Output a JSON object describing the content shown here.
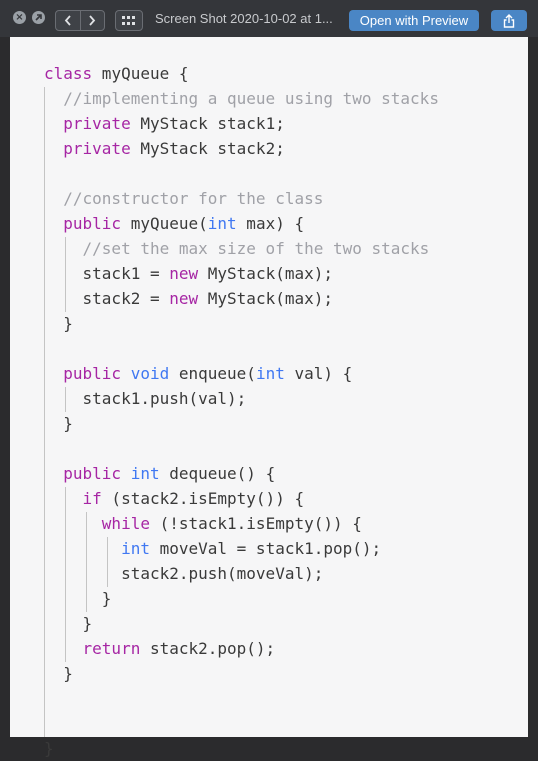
{
  "titlebar": {
    "title": "Screen Shot 2020-10-02 at 1...",
    "open_button": "Open with Preview",
    "icons": {
      "close": "close-icon",
      "fullscreen": "fullscreen-icon",
      "back": "chevron-left-icon",
      "forward": "chevron-right-icon",
      "grid": "grid-icon",
      "share": "share-icon"
    }
  },
  "colors": {
    "keyword": "#a626a4",
    "type": "#4078f2",
    "comment": "#a0a1a7",
    "text": "#3a3a3a",
    "button": "#4a86c5",
    "titlebar": "#34363a",
    "code_background": "#f6f6f7"
  },
  "code": {
    "language": "java",
    "lines": [
      [
        {
          "t": "kw",
          "s": "class"
        },
        {
          "t": "tx",
          "s": " myQueue {"
        }
      ],
      [
        {
          "t": "cm",
          "s": "  //implementing a queue using two stacks"
        }
      ],
      [
        {
          "t": "tx",
          "s": "  "
        },
        {
          "t": "kw",
          "s": "private"
        },
        {
          "t": "tx",
          "s": " MyStack stack1;"
        }
      ],
      [
        {
          "t": "tx",
          "s": "  "
        },
        {
          "t": "kw",
          "s": "private"
        },
        {
          "t": "tx",
          "s": " MyStack stack2;"
        }
      ],
      [],
      [
        {
          "t": "cm",
          "s": "  //constructor for the class"
        }
      ],
      [
        {
          "t": "tx",
          "s": "  "
        },
        {
          "t": "kw",
          "s": "public"
        },
        {
          "t": "tx",
          "s": " myQueue("
        },
        {
          "t": "ty",
          "s": "int"
        },
        {
          "t": "tx",
          "s": " max) {"
        }
      ],
      [
        {
          "t": "cm",
          "s": "    //set the max size of the two stacks"
        }
      ],
      [
        {
          "t": "tx",
          "s": "    stack1 = "
        },
        {
          "t": "kw",
          "s": "new"
        },
        {
          "t": "tx",
          "s": " MyStack(max);"
        }
      ],
      [
        {
          "t": "tx",
          "s": "    stack2 = "
        },
        {
          "t": "kw",
          "s": "new"
        },
        {
          "t": "tx",
          "s": " MyStack(max);"
        }
      ],
      [
        {
          "t": "tx",
          "s": "  }"
        }
      ],
      [],
      [
        {
          "t": "tx",
          "s": "  "
        },
        {
          "t": "kw",
          "s": "public"
        },
        {
          "t": "tx",
          "s": " "
        },
        {
          "t": "ty",
          "s": "void"
        },
        {
          "t": "tx",
          "s": " enqueue("
        },
        {
          "t": "ty",
          "s": "int"
        },
        {
          "t": "tx",
          "s": " val) {"
        }
      ],
      [
        {
          "t": "tx",
          "s": "    stack1.push(val);"
        }
      ],
      [
        {
          "t": "tx",
          "s": "  }"
        }
      ],
      [],
      [
        {
          "t": "tx",
          "s": "  "
        },
        {
          "t": "kw",
          "s": "public"
        },
        {
          "t": "tx",
          "s": " "
        },
        {
          "t": "ty",
          "s": "int"
        },
        {
          "t": "tx",
          "s": " dequeue() {"
        }
      ],
      [
        {
          "t": "tx",
          "s": "    "
        },
        {
          "t": "kw",
          "s": "if"
        },
        {
          "t": "tx",
          "s": " (stack2.isEmpty()) {"
        }
      ],
      [
        {
          "t": "tx",
          "s": "      "
        },
        {
          "t": "kw",
          "s": "while"
        },
        {
          "t": "tx",
          "s": " (!stack1.isEmpty()) {"
        }
      ],
      [
        {
          "t": "tx",
          "s": "        "
        },
        {
          "t": "ty",
          "s": "int"
        },
        {
          "t": "tx",
          "s": " moveVal = stack1.pop();"
        }
      ],
      [
        {
          "t": "tx",
          "s": "        stack2.push(moveVal);"
        }
      ],
      [
        {
          "t": "tx",
          "s": "      }"
        }
      ],
      [
        {
          "t": "tx",
          "s": "    }"
        }
      ],
      [
        {
          "t": "tx",
          "s": "    "
        },
        {
          "t": "kw",
          "s": "return"
        },
        {
          "t": "tx",
          "s": " stack2.pop();"
        }
      ],
      [
        {
          "t": "tx",
          "s": "  }"
        }
      ],
      [],
      [],
      [
        {
          "t": "tx",
          "s": "}"
        }
      ]
    ]
  }
}
